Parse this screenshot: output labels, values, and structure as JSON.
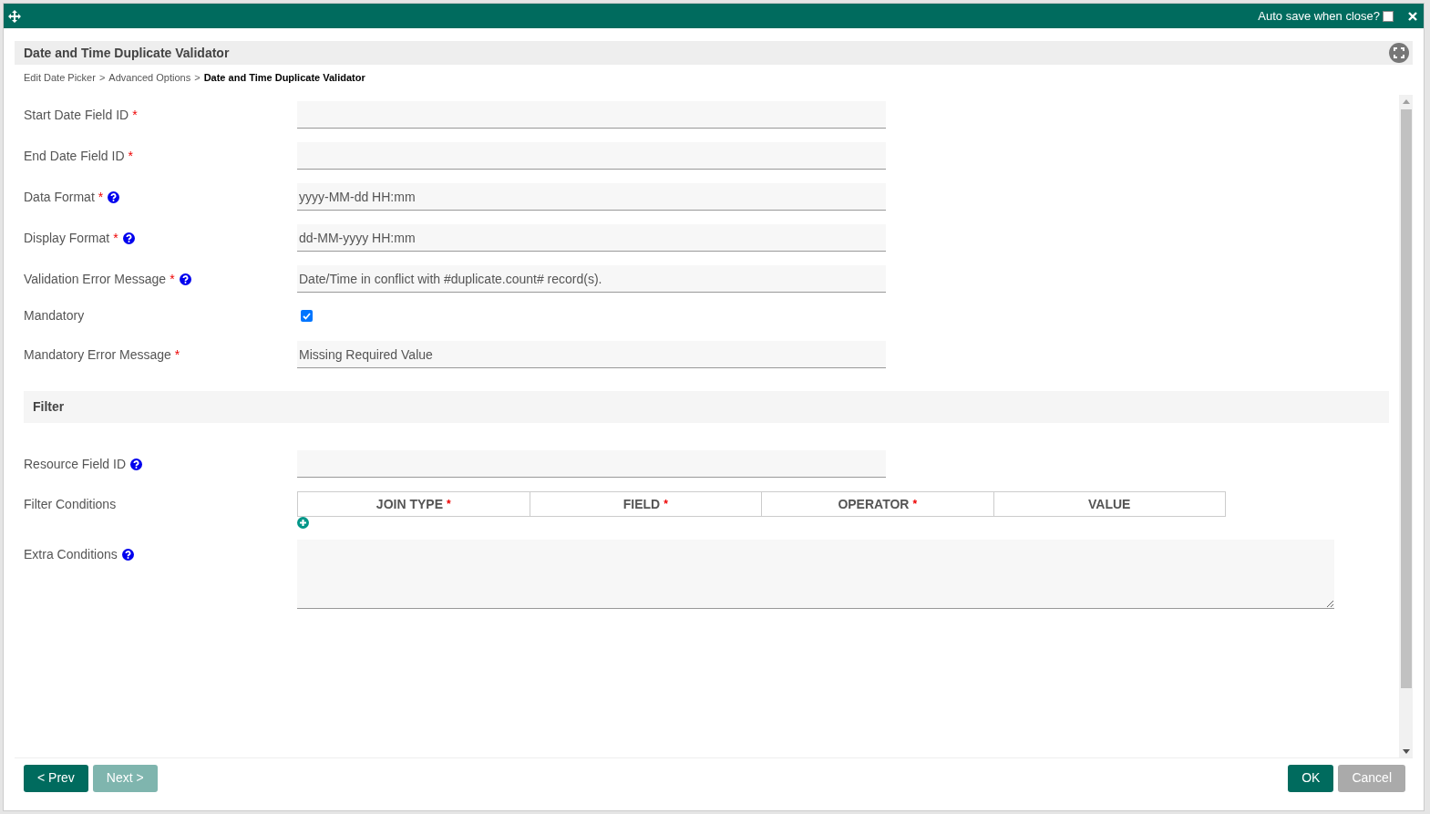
{
  "window": {
    "auto_save_label": "Auto save when close?",
    "auto_save_checked": false
  },
  "header": {
    "title": "Date and Time Duplicate Validator"
  },
  "breadcrumb": [
    {
      "label": "Edit Date Picker",
      "current": false
    },
    {
      "label": "Advanced Options",
      "current": false
    },
    {
      "label": "Date and Time Duplicate Validator",
      "current": true
    }
  ],
  "breadcrumb_separator": ">",
  "form": [
    {
      "kind": "text",
      "label": "Start Date Field ID",
      "required": true,
      "help": false
    },
    {
      "kind": "text",
      "label": "End Date Field ID",
      "required": true,
      "help": false
    },
    {
      "kind": "text",
      "label": "Data Format",
      "required": true,
      "help": true,
      "value": "yyyy-MM-dd HH:mm"
    },
    {
      "kind": "text",
      "label": "Display Format",
      "required": true,
      "help": true,
      "value": "dd-MM-yyyy HH:mm"
    },
    {
      "kind": "text",
      "label": "Validation Error Message",
      "required": true,
      "help": true,
      "value": "Date/Time in conflict with #duplicate.count# record(s)."
    },
    {
      "kind": "checkbox",
      "label": "Mandatory",
      "required": false,
      "help": false,
      "checked": true
    },
    {
      "kind": "text",
      "label": "Mandatory Error Message",
      "required": true,
      "help": false,
      "value": "Missing Required Value"
    },
    {
      "kind": "section",
      "label": "Filter"
    },
    {
      "kind": "text",
      "label": "Resource Field ID",
      "required": false,
      "help": true
    },
    {
      "kind": "table",
      "label": "Filter Conditions",
      "required": false,
      "help": false,
      "columns": [
        {
          "label": "JOIN TYPE",
          "required": true
        },
        {
          "label": "FIELD",
          "required": true
        },
        {
          "label": "OPERATOR",
          "required": true
        },
        {
          "label": "VALUE",
          "required": false
        }
      ]
    },
    {
      "kind": "textarea",
      "label": "Extra Conditions",
      "required": false,
      "help": true
    }
  ],
  "required_mark": "*",
  "buttons_left": [
    {
      "label": "< Prev",
      "disabled": false
    },
    {
      "label": "Next >",
      "disabled": true
    }
  ],
  "buttons_right": [
    {
      "label": "OK",
      "disabled": false
    },
    {
      "label": "Cancel",
      "disabled": true
    }
  ]
}
